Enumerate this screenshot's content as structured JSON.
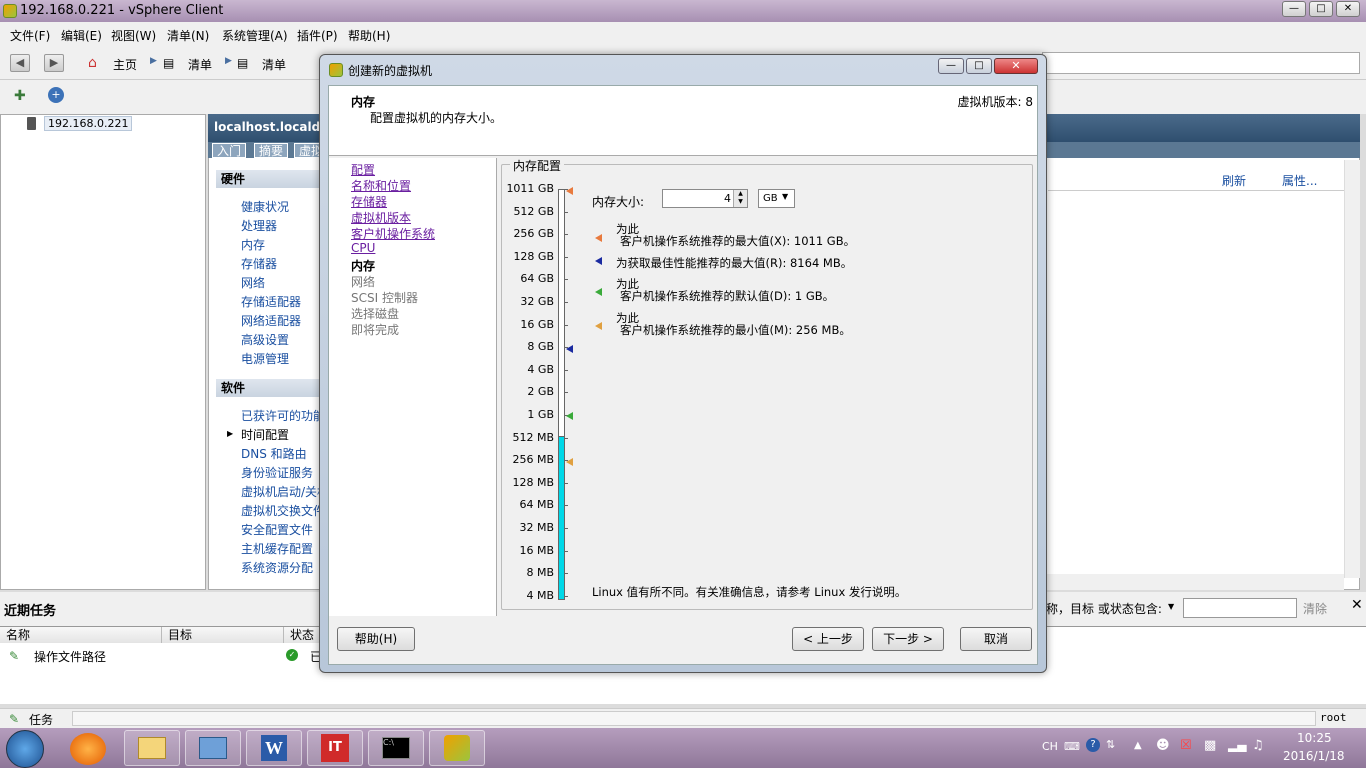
{
  "app": {
    "title": "192.168.0.221 - vSphere Client"
  },
  "menu": [
    "文件(F)",
    "编辑(E)",
    "视图(W)",
    "清单(N)",
    "系统管理(A)",
    "插件(P)",
    "帮助(H)"
  ],
  "breadcrumb": {
    "home": "主页",
    "inv1": "清单",
    "inv2": "清单"
  },
  "tree": {
    "host": "192.168.0.221"
  },
  "host_header": "localhost.localdom",
  "tabs": [
    "入门",
    "摘要",
    "虚拟"
  ],
  "hardware": {
    "title": "硬件",
    "items": [
      "健康状况",
      "处理器",
      "内存",
      "存储器",
      "网络",
      "存储适配器",
      "网络适配器",
      "高级设置",
      "电源管理"
    ]
  },
  "software": {
    "title": "软件",
    "items": [
      "已获许可的功能",
      "时间配置",
      "DNS 和路由",
      "身份验证服务",
      "虚拟机启动/关机",
      "虚拟机交换文件",
      "安全配置文件",
      "主机缓存配置",
      "系统资源分配"
    ]
  },
  "right_links": {
    "refresh": "刷新",
    "props": "属性..."
  },
  "recent": {
    "title": "近期任务",
    "filter_label": "称，目标 或状态包含:",
    "clear": "清除",
    "columns": [
      "名称",
      "目标",
      "状态"
    ],
    "row": {
      "name": "操作文件路径",
      "status": "已"
    }
  },
  "status": {
    "tasks": "任务",
    "user": "root"
  },
  "taskbar": {
    "ime": "CH",
    "time": "10:25",
    "date": "2016/1/18"
  },
  "dialog": {
    "title": "创建新的虚拟机",
    "header_title": "内存",
    "header_sub": "配置虚拟机的内存大小。",
    "version": "虚拟机版本: 8",
    "steps": [
      {
        "label": "配置",
        "state": "done"
      },
      {
        "label": "名称和位置",
        "state": "done"
      },
      {
        "label": "存储器",
        "state": "done"
      },
      {
        "label": "虚拟机版本",
        "state": "done"
      },
      {
        "label": "客户机操作系统",
        "state": "done"
      },
      {
        "label": "CPU",
        "state": "done"
      },
      {
        "label": "内存",
        "state": "current"
      },
      {
        "label": "网络",
        "state": "pending"
      },
      {
        "label": "SCSI 控制器",
        "state": "pending"
      },
      {
        "label": "选择磁盘",
        "state": "pending"
      },
      {
        "label": "即将完成",
        "state": "pending"
      }
    ],
    "group_title": "内存配置",
    "mem_label": "内存大小:",
    "mem_value": "4",
    "mem_unit": "GB",
    "scale": [
      "1011 GB",
      "512 GB",
      "256 GB",
      "128 GB",
      "64 GB",
      "32 GB",
      "16 GB",
      "8 GB",
      "4 GB",
      "2 GB",
      "1 GB",
      "512 MB",
      "256 MB",
      "128 MB",
      "64 MB",
      "32 MB",
      "16 MB",
      "8 MB",
      "4 MB"
    ],
    "selected_fraction_of_scale": 0.4,
    "legend": [
      {
        "line1": "为此",
        "line2": "客户机操作系统推荐的最大值(X): 1011 GB。",
        "color": "#e87a3e"
      },
      {
        "line1": "",
        "line2": "为获取最佳性能推荐的最大值(R): 8164 MB。",
        "color": "#1a2aa0"
      },
      {
        "line1": "为此",
        "line2": "客户机操作系统推荐的默认值(D): 1 GB。",
        "color": "#3aaa3a"
      },
      {
        "line1": "为此",
        "line2": "客户机操作系统推荐的最小值(M): 256 MB。",
        "color": "#e0a040"
      }
    ],
    "note": "Linux 值有所不同。有关准确信息，请参考 Linux 发行说明。",
    "buttons": {
      "help": "帮助(H)",
      "back": "< 上一步",
      "next": "下一步 >",
      "cancel": "取消"
    }
  }
}
